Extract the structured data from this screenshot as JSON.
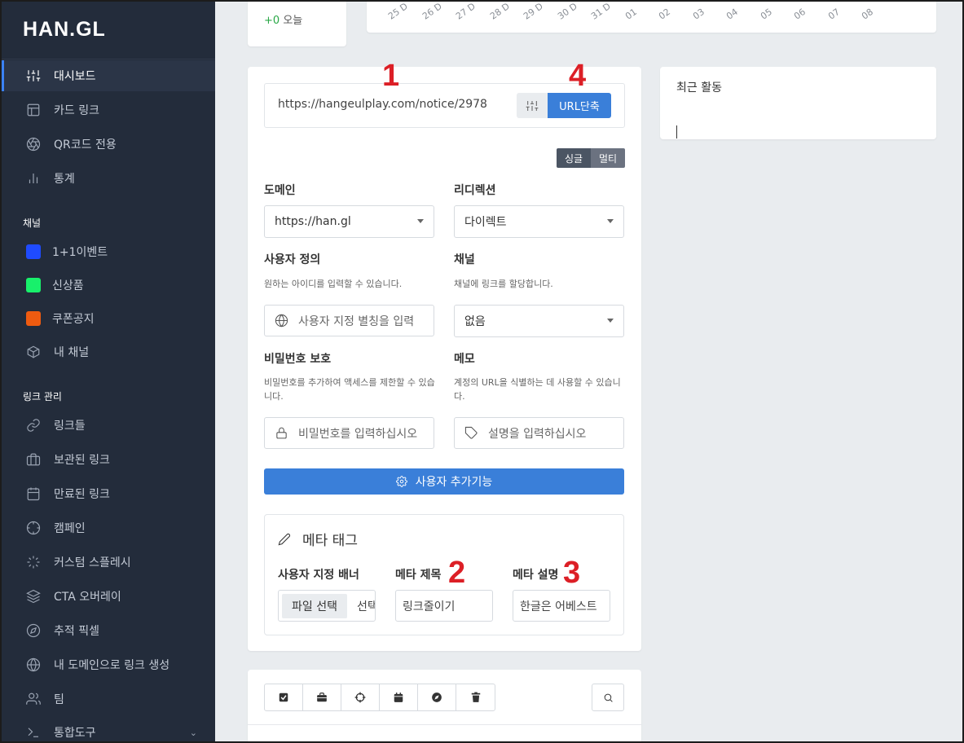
{
  "brand": {
    "logo": "HAN.GL"
  },
  "sidebar": {
    "main_items": [
      {
        "label": "대시보드",
        "icon": "sliders-icon",
        "active": true
      },
      {
        "label": "카드 링크",
        "icon": "layout-icon"
      },
      {
        "label": "QR코드 전용",
        "icon": "aperture-icon"
      },
      {
        "label": "통계",
        "icon": "bar-chart-icon"
      }
    ],
    "channels_heading": "채널",
    "channels": [
      {
        "label": "1+1이벤트",
        "color": "#1f4bff"
      },
      {
        "label": "신상품",
        "color": "#18f06b"
      },
      {
        "label": "쿠폰공지",
        "color": "#ee5b10"
      },
      {
        "label": "내 채널",
        "icon": "box-icon"
      }
    ],
    "links_heading": "링크 관리",
    "link_items": [
      {
        "label": "링크들",
        "icon": "link-icon"
      },
      {
        "label": "보관된 링크",
        "icon": "briefcase-icon"
      },
      {
        "label": "만료된 링크",
        "icon": "calendar-icon"
      },
      {
        "label": "캠페인",
        "icon": "crosshair-icon"
      },
      {
        "label": "커스텀 스플레시",
        "icon": "loader-icon"
      },
      {
        "label": "CTA 오버레이",
        "icon": "layers-icon"
      },
      {
        "label": "추적 픽셀",
        "icon": "compass-icon"
      },
      {
        "label": "내 도메인으로 링크 생성",
        "icon": "globe-icon"
      },
      {
        "label": "팀",
        "icon": "users-icon"
      },
      {
        "label": "통합도구",
        "icon": "terminal-icon"
      }
    ]
  },
  "stats": {
    "change_value": "+0",
    "change_label": "오늘"
  },
  "chart_axis": {
    "ticks": [
      "25 D",
      "26 D",
      "27 D",
      "28 D",
      "29 D",
      "30 D",
      "31 D",
      "01",
      "02",
      "03",
      "04",
      "05",
      "06",
      "07",
      "08"
    ]
  },
  "form": {
    "url_value": "https://hangeulplay.com/notice/2978",
    "shorten_label": "URL단축",
    "toggle_single": "싱글",
    "toggle_multi": "멀티",
    "domain_label": "도메인",
    "domain_value": "https://han.gl",
    "redirect_label": "리디렉션",
    "redirect_value": "다이렉트",
    "custom_label": "사용자 정의",
    "custom_help": "원하는 아이디를 입력할 수 있습니다.",
    "custom_placeholder": "사용자 지정 별칭을 입력",
    "channel_label": "채널",
    "channel_help": "채널에 링크를 할당합니다.",
    "channel_value": "없음",
    "password_label": "비밀번호 보호",
    "password_help": "비밀번호를 추가하여 액세스를 제한할 수 있습니다.",
    "password_placeholder": "비밀번호를 입력하십시오",
    "memo_label": "메모",
    "memo_help": "계정의 URL을 식별하는 데 사용할 수 있습니다.",
    "memo_placeholder": "설명을 입력하십시오",
    "extra_button": "사용자 추가기능"
  },
  "meta": {
    "title": "메타 태그",
    "banner_label": "사용자 지정 배너",
    "file_button": "파일 선택",
    "file_status": "선택",
    "meta_title_label": "메타 제목",
    "meta_title_value": "링크줄이기",
    "meta_desc_label": "메타 설명",
    "meta_desc_value": "한글은 어베스트"
  },
  "markers": [
    "1",
    "2",
    "3",
    "4"
  ],
  "activity": {
    "title": "최근 활동"
  },
  "toolbar_icons": [
    "check-square-icon",
    "briefcase-icon",
    "crosshair-icon",
    "calendar-icon",
    "compass-icon",
    "trash-icon",
    "search-icon"
  ],
  "colors": {
    "sidebar_bg": "#232c3b",
    "primary": "#3a7fd9",
    "marker": "#dc1f26"
  }
}
